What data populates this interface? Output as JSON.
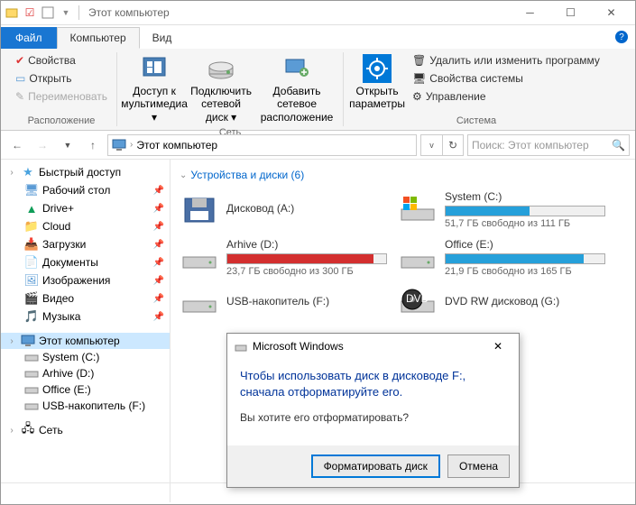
{
  "window": {
    "title": "Этот компьютер"
  },
  "tabs": {
    "file": "Файл",
    "computer": "Компьютер",
    "view": "Вид"
  },
  "ribbon": {
    "properties": "Свойства",
    "open": "Открыть",
    "rename": "Переименовать",
    "location_group": "Расположение",
    "media_access": "Доступ к мультимедиа",
    "map_drive": "Подключить сетевой диск",
    "add_netloc": "Добавить сетевое расположение",
    "network_group": "Сеть",
    "open_settings": "Открыть параметры",
    "uninstall": "Удалить или изменить программу",
    "sys_props": "Свойства системы",
    "manage": "Управление",
    "system_group": "Система"
  },
  "address": {
    "path": "Этот компьютер"
  },
  "search": {
    "placeholder": "Поиск: Этот компьютер"
  },
  "sidebar": {
    "quick": "Быстрый доступ",
    "items": [
      {
        "label": "Рабочий стол"
      },
      {
        "label": "Drive+"
      },
      {
        "label": "Cloud"
      },
      {
        "label": "Загрузки"
      },
      {
        "label": "Документы"
      },
      {
        "label": "Изображения"
      },
      {
        "label": "Видео"
      },
      {
        "label": "Музыка"
      }
    ],
    "thispc": "Этот компьютер",
    "drives": [
      {
        "label": "System (C:)"
      },
      {
        "label": "Arhive (D:)"
      },
      {
        "label": "Office (E:)"
      },
      {
        "label": "USB-накопитель (F:)"
      }
    ],
    "network": "Сеть"
  },
  "group": {
    "title": "Устройства и диски (6)"
  },
  "drives": [
    {
      "name": "Дисковод (A:)",
      "sub": "",
      "fill": 0,
      "color": "",
      "kind": "floppy"
    },
    {
      "name": "System (C:)",
      "sub": "51,7 ГБ свободно из 111 ГБ",
      "fill": 53,
      "color": "blue",
      "kind": "win"
    },
    {
      "name": "Arhive (D:)",
      "sub": "23,7 ГБ свободно из 300 ГБ",
      "fill": 92,
      "color": "red",
      "kind": "hdd"
    },
    {
      "name": "Office (E:)",
      "sub": "21,9 ГБ свободно из 165 ГБ",
      "fill": 87,
      "color": "blue",
      "kind": "hdd"
    },
    {
      "name": "USB-накопитель (F:)",
      "sub": "",
      "fill": 0,
      "color": "",
      "kind": "hdd"
    },
    {
      "name": "DVD RW дисковод (G:)",
      "sub": "",
      "fill": 0,
      "color": "",
      "kind": "dvd"
    }
  ],
  "dialog": {
    "title": "Microsoft Windows",
    "main": "Чтобы использовать диск в дисководе F:, сначала отформатируйте его.",
    "sub": "Вы хотите его отформатировать?",
    "format_btn": "Форматировать диск",
    "cancel_btn": "Отмена"
  }
}
